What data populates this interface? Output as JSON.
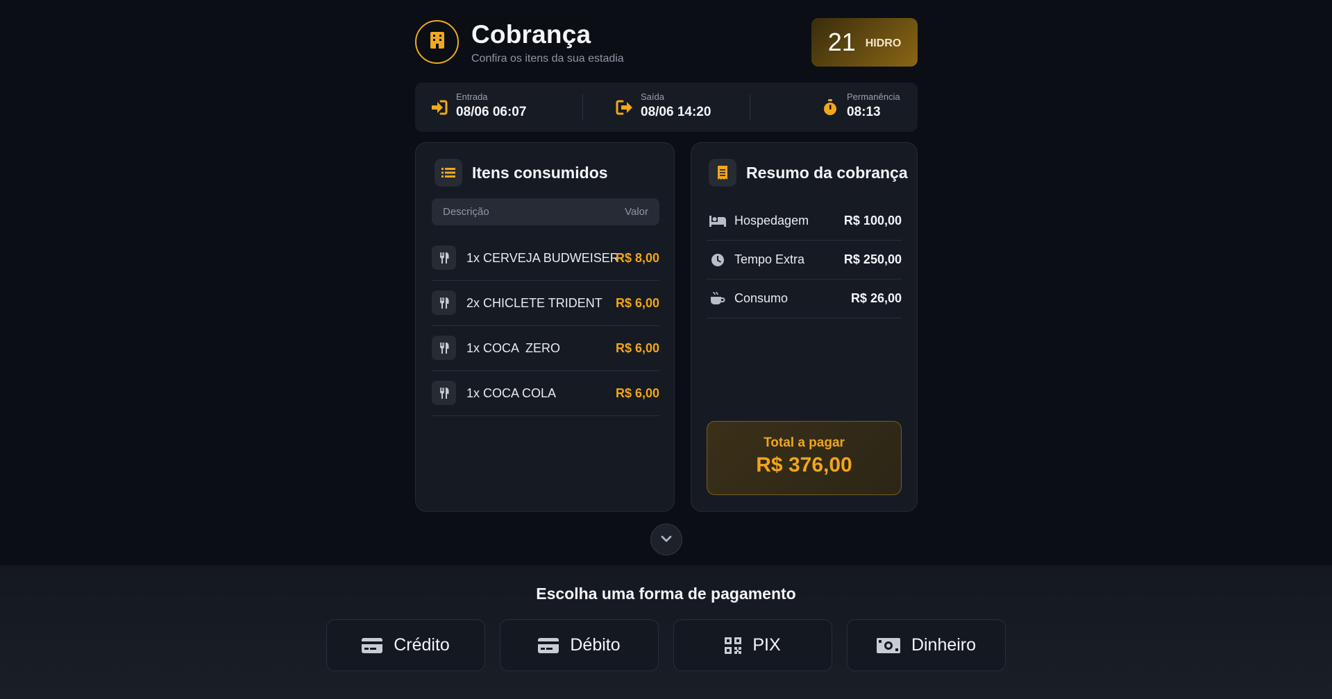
{
  "header": {
    "title": "Cobrança",
    "subtitle": "Confira os itens da sua estadia",
    "room_number": "21",
    "room_type": "HIDRO",
    "logo_icon": "building-icon"
  },
  "stay": {
    "checkin_label": "Entrada",
    "checkin_value": "08/06 06:07",
    "checkout_label": "Saída",
    "checkout_value": "08/06 14:20",
    "duration_label": "Permanência",
    "duration_value": "08:13"
  },
  "items_panel": {
    "title": "Itens consumidos",
    "col_description": "Descrição",
    "col_value": "Valor",
    "items": [
      {
        "description": "1x CERVEJA BUDWEISER",
        "value": "R$ 8,00"
      },
      {
        "description": "2x CHICLETE TRIDENT",
        "value": "R$ 6,00"
      },
      {
        "description": "1x COCA  ZERO",
        "value": "R$ 6,00"
      },
      {
        "description": "1x COCA COLA",
        "value": "R$ 6,00"
      }
    ]
  },
  "summary_panel": {
    "title": "Resumo da cobrança",
    "rows": [
      {
        "label": "Hospedagem",
        "value": "R$ 100,00",
        "icon": "bed-icon"
      },
      {
        "label": "Tempo Extra",
        "value": "R$ 250,00",
        "icon": "clock-icon"
      },
      {
        "label": "Consumo",
        "value": "R$ 26,00",
        "icon": "coffee-cup-icon"
      }
    ],
    "total_label": "Total a pagar",
    "total_value": "R$ 376,00"
  },
  "payment": {
    "title": "Escolha uma forma de pagamento",
    "methods": [
      {
        "label": "Crédito",
        "icon": "credit-card-icon"
      },
      {
        "label": "Débito",
        "icon": "credit-card-icon"
      },
      {
        "label": "PIX",
        "icon": "qr-code-icon"
      },
      {
        "label": "Dinheiro",
        "icon": "money-bill-icon"
      }
    ]
  },
  "colors": {
    "accent": "#f2a51a",
    "background": "#0b0e14",
    "panel": "#161a23"
  }
}
